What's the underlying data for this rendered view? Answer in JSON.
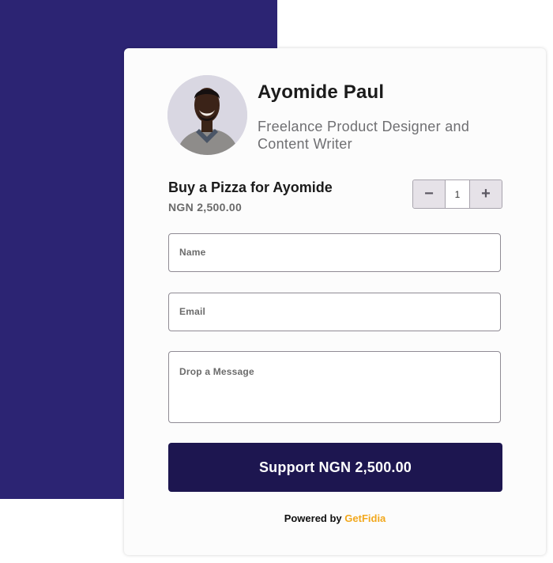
{
  "theme": {
    "backdrop_color": "#2c2473",
    "button_color": "#1d1650",
    "brand_color": "#f2a81d"
  },
  "profile": {
    "name": "Ayomide Paul",
    "bio": "Freelance Product Designer and Content Writer",
    "avatar_icon": "profile-photo"
  },
  "product": {
    "title": "Buy a Pizza for Ayomide",
    "price": "NGN 2,500.00"
  },
  "quantity": {
    "decrement_symbol": "−",
    "value": "1",
    "increment_symbol": "+"
  },
  "form": {
    "name_placeholder": "Name",
    "email_placeholder": "Email",
    "message_placeholder": "Drop a Message"
  },
  "submit_label": "Support NGN 2,500.00",
  "footer": {
    "powered_by": "Powered by",
    "brand": "GetFidia"
  }
}
